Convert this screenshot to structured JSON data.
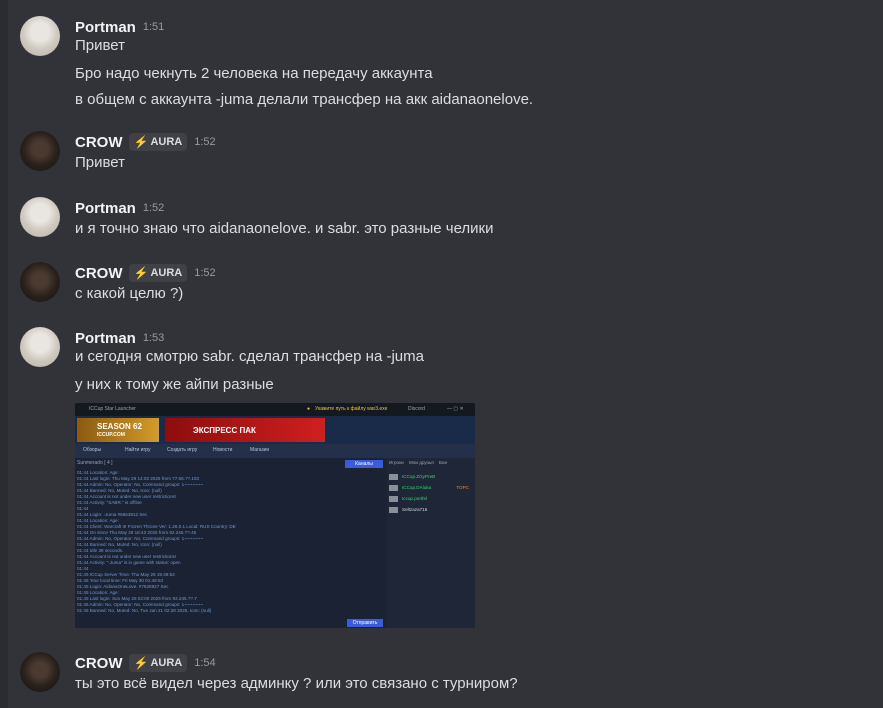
{
  "messages": [
    {
      "author": "Portman",
      "time": "1:51",
      "lines": [
        "Привет",
        "Бро надо чекнуть 2 человека на передачу аккаунта",
        "в общем с аккаунта -juma делали трансфер на акк aidanaonelove."
      ]
    },
    {
      "author": "CROW",
      "badge": "AURA",
      "time": "1:52",
      "lines": [
        "Привет"
      ]
    },
    {
      "author": "Portman",
      "time": "1:52",
      "lines": [
        "и я точно знаю что aidanaonelove. и sabr. это разные челики"
      ]
    },
    {
      "author": "CROW",
      "badge": "AURA",
      "time": "1:52",
      "lines": [
        "с какой целю ?)"
      ]
    },
    {
      "author": "Portman",
      "time": "1:53",
      "lines": [
        "и сегодня смотрю sabr. сделал трансфер на -juma",
        "у них к тому же айпи разные"
      ]
    },
    {
      "author": "CROW",
      "badge": "AURA",
      "time": "1:54",
      "lines": [
        "ты это всё видел через админку ? или это связано с турниром?"
      ]
    }
  ],
  "attachment": {
    "window_title": "ICCup Star Launcher",
    "notice": "Укажите путь к файлу war3.exe",
    "discord": "Discord",
    "season": "SEASON 62",
    "season_site": "ICCUP.COM",
    "promo": "ЭКСПРЕСС ПАК",
    "tabs": [
      "Обзоры",
      "Найти игру",
      "Создать игру",
      "Новости",
      "Магазин"
    ],
    "chat_header": "Sunmerado [ 4 ]",
    "channels_button": "Каналы",
    "send_button": "Отправить",
    "side_tabs": [
      "Игроки",
      "Мои друзья",
      "Бан"
    ],
    "side_players": [
      {
        "name": "ICCup.ZGyPreB",
        "color": "#36d66b"
      },
      {
        "name": "ICCup.DAluka",
        "color": "#36d66b",
        "tag": "TOPC"
      },
      {
        "name": "Iccup.portfel",
        "color": "#36d66b"
      },
      {
        "name": "Seltzaza716",
        "color": "#cfd5e0"
      }
    ],
    "log": [
      "01:44 Location:                 Age:",
      "01:44 Last login: Thu May 29 14:03 2025 from 77.56.??.103",
      "01:44 Admin: No, Operator: No, Command groups: 1~~~~~~~",
      "01:44 Banned: No, Muted: No, Icon: (null)",
      "01:44 Account is not under new user restrictions!",
      "01:44 Activity: \"SABR.\" is offline",
      "01:44",
      "01:44 Login: -Juma              #6653912 Sec",
      "01:44 Location:                 Age:",
      "01:44 Client: Warcraft III Frozen Throne  Ver: 1.26.0.1  Local: RUS  Country: DE",
      "01:44 On since Thu May 29 18:43 2025 from 92.245.??.45",
      "01:44 Admin: No, Operator: No, Command groups: 1~~~~~~~",
      "01:44 Banned: No, Muted: No, Icon: (null)",
      "01:44 Idle 38 seconds.",
      "01:44 Account is not under new user restrictions!",
      "01:44 Activity: \"-Juma\" is in game with status: open",
      "01:44",
      "01:45 ICCup Server Time: Thu May 29 19:48:53",
      "01:45 Your local time: Fri May 30 01:48:53",
      "01:45 Login: AidanaOneLove.   #7528927 Sec",
      "01:45 Location:                 Age:",
      "01:45 Last login: Sun May 25 02:00 2025 from 92.245.??.7",
      "01:45 Admin: No, Operator: No, Command groups: 1~~~~~~~",
      "01:45 Banned: No, Muted: No, Tue Jan 21 02:28 2025, Icon: (null)"
    ]
  }
}
